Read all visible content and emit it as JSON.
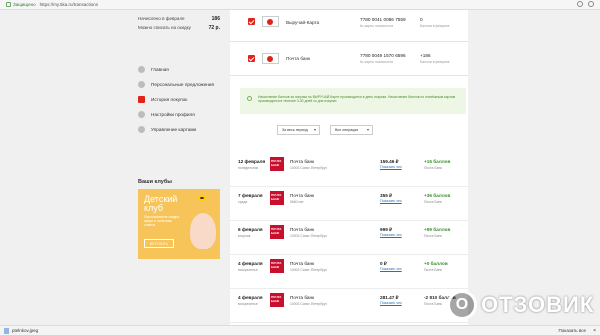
{
  "browser": {
    "secure_label": "Защищено",
    "url": "https://my.5ka.ru/transactions"
  },
  "sidebar": {
    "balance_rows": [
      {
        "label": "Начислено в феврале",
        "value": "186"
      },
      {
        "label": "Можно списать на скидку",
        "value": "72 р."
      }
    ],
    "menu": [
      {
        "label": "Главная",
        "icon": "home-icon",
        "active": false
      },
      {
        "label": "Персональные предложения",
        "icon": "tag-icon",
        "active": false
      },
      {
        "label": "История покупок",
        "icon": "receipt-icon",
        "active": true
      },
      {
        "label": "Настройки профиля",
        "icon": "settings-icon",
        "active": false
      },
      {
        "label": "Управление картами",
        "icon": "cards-icon",
        "active": false
      }
    ],
    "clubs_title": "Ваши клубы",
    "club": {
      "title_line1": "Детский",
      "title_line2": "клуб",
      "description": "Персональные скидки, акции и полезные советы",
      "button": "ВСТУПИТЬ"
    }
  },
  "cards": [
    {
      "name": "Выручай-Карта",
      "number": "7780 0041 0086 7559",
      "number_sub": "№ карты лояльности",
      "value": "0",
      "value_sub": "Баллов в феврале"
    },
    {
      "name": "Почта банк",
      "number": "7780 0049 1570 6596",
      "number_sub": "№ карты лояльности",
      "value": "+186",
      "value_sub": "Баллов в феврале"
    }
  ],
  "info_text": "Начисление баллов за покупки по ВЫРУЧАЙ-Карте производится в день покупки. Начисление баллов по платёжным картам производится в течение 3-30 дней со дня покупки.",
  "filters": {
    "period": "За весь период",
    "operations": "Все операции"
  },
  "transactions": [
    {
      "date": "12 февраля",
      "day": "понедельник",
      "merchant": "Почта банк",
      "city": "10003 Санкт-Петербург",
      "amount": "159.46 ₽",
      "link": "Показать чек",
      "bonus": "+16 баллов",
      "bonus_sub": "Почта Банк"
    },
    {
      "date": "7 февраля",
      "day": "среда",
      "merchant": "Почта банк",
      "city": "5660 пат",
      "amount": "355 ₽",
      "link": "Показать чек",
      "bonus": "+36 баллов",
      "bonus_sub": "Почта Банк"
    },
    {
      "date": "6 февраля",
      "day": "вторник",
      "merchant": "Почта банк",
      "city": "10003 Санкт-Петербург",
      "amount": "999 ₽",
      "link": "Показать чек",
      "bonus": "+99 баллов",
      "bonus_sub": "Почта Банк"
    },
    {
      "date": "4 февраля",
      "day": "воскресенье",
      "merchant": "Почта банк",
      "city": "10003 Санкт-Петербург",
      "amount": "0 ₽",
      "link": "Показать чек",
      "bonus": "+0 баллов",
      "bonus_sub": "Почта Банк"
    },
    {
      "date": "4 февраля",
      "day": "воскресенье",
      "merchant": "Почта банк",
      "city": "10003 Санкт-Петербург",
      "amount": "281.47 ₽",
      "link": "Показать чек",
      "bonus": "-2 810 баллов",
      "bonus_sub": "Почта Банк"
    }
  ],
  "bank_logo_text": "ПОЧТА БАНК",
  "downloads": {
    "file": "ptelnkov.jpeg",
    "show_all": "Показать все"
  },
  "watermark": {
    "letter": "О",
    "word": "ОТЗОВИК"
  }
}
